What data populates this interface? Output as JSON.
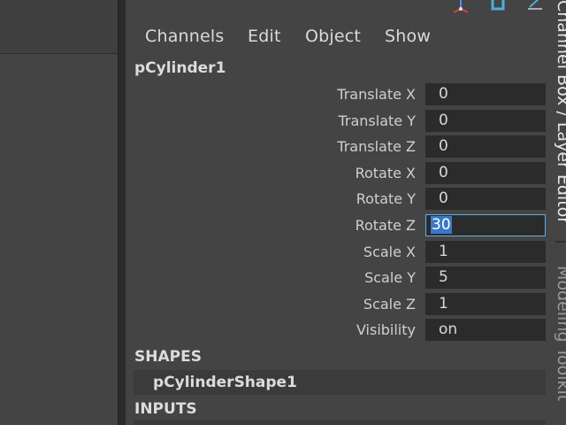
{
  "menubar": {
    "channels": "Channels",
    "edit": "Edit",
    "object": "Object",
    "show": "Show"
  },
  "object_name": "pCylinder1",
  "attributes": [
    {
      "label": "Translate X",
      "value": "0"
    },
    {
      "label": "Translate Y",
      "value": "0"
    },
    {
      "label": "Translate Z",
      "value": "0"
    },
    {
      "label": "Rotate X",
      "value": "0"
    },
    {
      "label": "Rotate Y",
      "value": "0"
    },
    {
      "label": "Rotate Z",
      "value": "30"
    },
    {
      "label": "Scale X",
      "value": "1"
    },
    {
      "label": "Scale Y",
      "value": "5"
    },
    {
      "label": "Scale Z",
      "value": "1"
    },
    {
      "label": "Visibility",
      "value": "on"
    }
  ],
  "sections": {
    "shapes": "SHAPES",
    "shape_name": "pCylinderShape1",
    "inputs": "INPUTS"
  },
  "side_tabs": {
    "channel_box": "Channel Box / Layer Editor",
    "modeling_toolkit": "Modeling Toolkit"
  },
  "icons": [
    "move-tool-icon",
    "attribute-editor-icon",
    "tool-settings-icon"
  ],
  "colors": {
    "background": "#444444",
    "field": "#2b2b2b",
    "active_border": "#5ab0f0",
    "selection": "#3a78c8"
  }
}
